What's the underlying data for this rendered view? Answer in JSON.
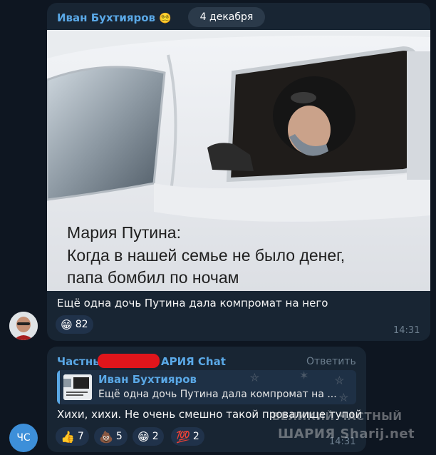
{
  "message1": {
    "sender_name": "Иван Бухтияров",
    "sender_badge": "😵‍💫",
    "date_label": "4 декабря",
    "image_text": {
      "line1": "Мария Путина:",
      "line2": "Когда в нашей семье не было денег,",
      "line3": "папа бомбил по ночам"
    },
    "caption": "Ещё одна дочь Путина дала компромат на него",
    "reactions": [
      {
        "emoji": "😁",
        "count": "82"
      }
    ],
    "time": "14:31"
  },
  "message2": {
    "sender_prefix": "Частны",
    "sender_suffix": "АРИЯ Chat",
    "reply_action": "Ответить",
    "quoted": {
      "author": "Иван Бухтияров",
      "text": "Ещё одна дочь Путина дала компромат на ..."
    },
    "text": "Хихи, хихи. Не очень смешно такой провалище тупой",
    "reactions": [
      {
        "emoji": "👍",
        "count": "7"
      },
      {
        "emoji": "💩",
        "count": "5"
      },
      {
        "emoji": "😁",
        "count": "2"
      },
      {
        "emoji": "💯",
        "count": "2"
      }
    ],
    "time": "14:31"
  },
  "avatar2_initials": "ЧС",
  "watermark": {
    "line1": "ВЕЛИКИЙ ЧАСТНЫЙ",
    "line2": "ШАРИЯ Sharij.net"
  },
  "colors": {
    "background": "#0e1621",
    "bubble": "#182533",
    "accent": "#5aa8e6",
    "reaction": "#20324a",
    "avatar2": "#3d8fd9",
    "redaction": "#e0151b"
  }
}
